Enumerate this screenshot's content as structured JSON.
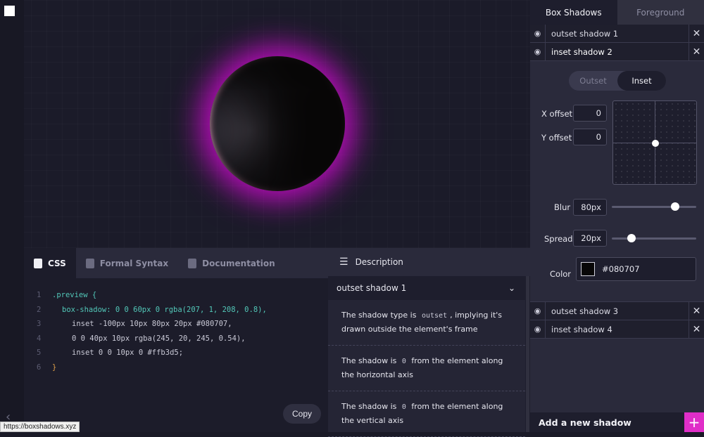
{
  "status_url": "https://boxshadows.xyz",
  "code_panel": {
    "tabs": [
      {
        "label": "CSS",
        "active": true
      },
      {
        "label": "Formal Syntax",
        "active": false
      },
      {
        "label": "Documentation",
        "active": false
      }
    ],
    "lines": [
      {
        "n": "1",
        "text": ".preview {"
      },
      {
        "n": "2",
        "text": "box-shadow: 0 0 60px 0 rgba(207, 1, 208, 0.8),"
      },
      {
        "n": "3",
        "text": "inset -100px 10px 80px 20px #080707,"
      },
      {
        "n": "4",
        "text": "0 0 40px 10px rgba(245, 20, 245, 0.54),"
      },
      {
        "n": "5",
        "text": "inset 0 0 10px 0 #ffb3d5;"
      },
      {
        "n": "6",
        "text": "}"
      }
    ],
    "copy_label": "Copy"
  },
  "description": {
    "title": "Description",
    "selected_shadow": "outset shadow 1",
    "items": [
      {
        "pre": "The shadow type is ",
        "code": "outset",
        "post": ", implying it's drawn outside the element's frame"
      },
      {
        "pre": "The shadow is ",
        "code": "0",
        "post": " from the element along the horizontal axis"
      },
      {
        "pre": "The shadow is ",
        "code": "0",
        "post": " from the element along the vertical axis"
      }
    ]
  },
  "right_panel": {
    "tabs": [
      {
        "label": "Box Shadows",
        "active": true
      },
      {
        "label": "Foreground",
        "active": false
      }
    ],
    "shadows_top": [
      {
        "name": "outset shadow 1"
      },
      {
        "name": "inset shadow 2"
      }
    ],
    "editor": {
      "type_options": [
        "Outset",
        "Inset"
      ],
      "type_selected": "Inset",
      "x_offset_label": "X offset",
      "x_offset": "0",
      "y_offset_label": "Y offset",
      "y_offset": "0",
      "blur_label": "Blur",
      "blur": "80px",
      "blur_fraction": 0.78,
      "spread_label": "Spread",
      "spread": "20px",
      "spread_fraction": 0.2,
      "color_label": "Color",
      "color": "#080707"
    },
    "shadows_bottom": [
      {
        "name": "outset shadow 3"
      },
      {
        "name": "inset shadow 4"
      }
    ],
    "add_label": "Add a new shadow",
    "add_icon": "+"
  },
  "accent_color": "#e02ec8"
}
